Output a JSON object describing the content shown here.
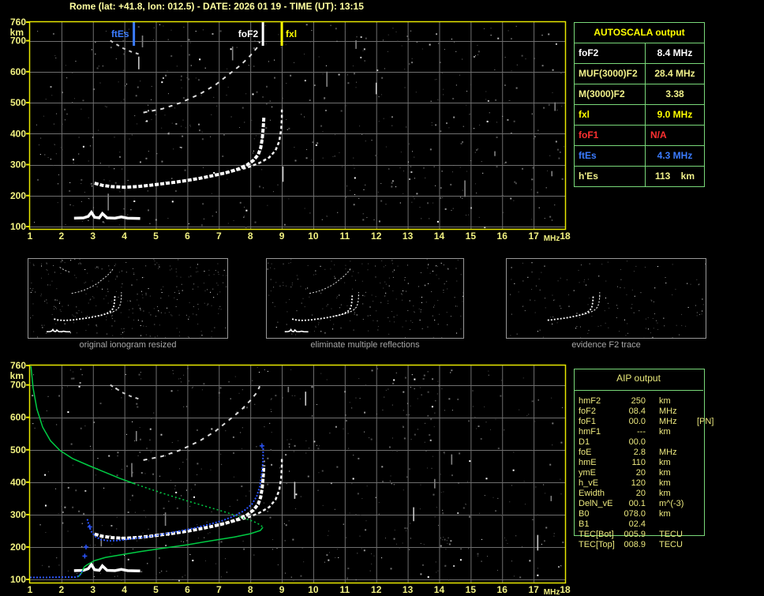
{
  "title": "Rome (lat: +41.8, lon: 012.5) - DATE: 2026 01 19 - TIME (UT): 13:15",
  "colors": {
    "background": "#000000",
    "plot_border": "#e8e800",
    "grid": "#6f6f6f",
    "axis_text": "#f0f080",
    "table_border": "#79d879",
    "bright_yellow": "#ffff00",
    "pale_yellow": "#f0f08a",
    "white": "#ffffff",
    "red": "#ff3030",
    "blue": "#3b7cff",
    "green_profile": "#00cc44",
    "caption_gray": "#a8a8a8"
  },
  "chart_data": {
    "type": "scatter",
    "title": "AUTOSCALA automatic ionogram scaling - Rome",
    "xlabel": "MHz",
    "ylabel": "km",
    "xlim": [
      1,
      18
    ],
    "ylim": [
      100,
      760
    ],
    "x_ticks": [
      1,
      2,
      3,
      4,
      5,
      6,
      7,
      8,
      9,
      10,
      11,
      12,
      13,
      14,
      15,
      16,
      17,
      18
    ],
    "y_ticks": [
      760,
      700,
      600,
      500,
      400,
      300,
      200,
      100
    ],
    "grid": true,
    "markers": [
      {
        "label": "ftEs",
        "f": 4.3,
        "color": "#3b7cff",
        "label_side": "left"
      },
      {
        "label": "foF2",
        "f": 8.4,
        "color": "#ffffff",
        "label_side": "left"
      },
      {
        "label": "fxl",
        "f": 9.0,
        "color": "#ffff00",
        "label_side": "right"
      }
    ],
    "series": [
      {
        "name": "f2-ordinary-trace",
        "color": "#ffffff",
        "width": 4,
        "dash": "5,2",
        "plots": [
          "top",
          "bottom",
          "t0",
          "t1",
          "t2"
        ],
        "points": [
          [
            3.05,
            240
          ],
          [
            3.3,
            233
          ],
          [
            3.6,
            229
          ],
          [
            4.0,
            227
          ],
          [
            4.4,
            229
          ],
          [
            4.8,
            233
          ],
          [
            5.2,
            238
          ],
          [
            5.6,
            243
          ],
          [
            6.0,
            249
          ],
          [
            6.4,
            256
          ],
          [
            6.8,
            264
          ],
          [
            7.2,
            273
          ],
          [
            7.6,
            285
          ],
          [
            7.9,
            299
          ],
          [
            8.1,
            314
          ],
          [
            8.25,
            332
          ],
          [
            8.33,
            354
          ],
          [
            8.38,
            384
          ],
          [
            8.41,
            418
          ],
          [
            8.43,
            452
          ]
        ]
      },
      {
        "name": "f2-extraordinary-trace",
        "color": "#f4f4f4",
        "width": 2.5,
        "dash": "4,3",
        "plots": [
          "top",
          "bottom",
          "t0",
          "t1",
          "t2"
        ],
        "points": [
          [
            6.9,
            268
          ],
          [
            7.4,
            277
          ],
          [
            7.9,
            290
          ],
          [
            8.3,
            306
          ],
          [
            8.6,
            323
          ],
          [
            8.8,
            346
          ],
          [
            8.92,
            376
          ],
          [
            8.98,
            415
          ],
          [
            9.0,
            452
          ],
          [
            9.0,
            478
          ]
        ]
      },
      {
        "name": "es-layer-trace",
        "color": "#ffffff",
        "width": 3.5,
        "dash": "",
        "plots": [
          "top",
          "bottom",
          "t0",
          "t1"
        ],
        "points": [
          [
            2.4,
            127
          ],
          [
            2.7,
            128
          ],
          [
            2.85,
            133
          ],
          [
            2.95,
            146
          ],
          [
            3.05,
            130
          ],
          [
            3.2,
            128
          ],
          [
            3.3,
            142
          ],
          [
            3.45,
            128
          ],
          [
            3.7,
            127
          ],
          [
            3.9,
            131
          ],
          [
            4.1,
            127
          ],
          [
            4.5,
            126
          ]
        ]
      },
      {
        "name": "second-hop-trace",
        "color": "#dddddd",
        "width": 2,
        "dash": "5,6",
        "plots": [
          "top",
          "bottom",
          "t0",
          "t1"
        ],
        "points": [
          [
            4.6,
            468
          ],
          [
            5.2,
            480
          ],
          [
            5.8,
            500
          ],
          [
            6.4,
            528
          ],
          [
            6.9,
            558
          ],
          [
            7.3,
            590
          ],
          [
            7.7,
            622
          ],
          [
            8.0,
            652
          ],
          [
            8.2,
            676
          ],
          [
            8.3,
            696
          ]
        ]
      },
      {
        "name": "second-hop-fragment",
        "color": "#cccccc",
        "width": 2,
        "dash": "4,5",
        "plots": [
          "top",
          "bottom",
          "t0"
        ],
        "points": [
          [
            3.55,
            700
          ],
          [
            3.75,
            688
          ],
          [
            3.95,
            676
          ],
          [
            4.2,
            665
          ],
          [
            4.45,
            657
          ]
        ]
      },
      {
        "name": "aip-profile-topside",
        "color": "#00cc44",
        "width": 1.5,
        "dash": "",
        "plots": [
          "bottom"
        ],
        "points": [
          [
            1.03,
            758
          ],
          [
            1.1,
            690
          ],
          [
            1.22,
            625
          ],
          [
            1.4,
            570
          ],
          [
            1.65,
            528
          ],
          [
            1.95,
            498
          ],
          [
            2.35,
            473
          ],
          [
            2.85,
            452
          ],
          [
            3.35,
            432
          ],
          [
            3.85,
            412
          ],
          [
            4.3,
            396
          ]
        ]
      },
      {
        "name": "aip-profile-dotted",
        "color": "#00cc44",
        "width": 1.5,
        "dash": "2,3",
        "plots": [
          "bottom"
        ],
        "points": [
          [
            4.3,
            396
          ],
          [
            4.8,
            379
          ],
          [
            5.4,
            360
          ],
          [
            6.0,
            342
          ],
          [
            6.6,
            325
          ],
          [
            7.2,
            308
          ],
          [
            7.7,
            292
          ],
          [
            8.1,
            279
          ],
          [
            8.32,
            268
          ],
          [
            8.4,
            261
          ]
        ]
      },
      {
        "name": "aip-profile-bottomside",
        "color": "#00cc44",
        "width": 1.5,
        "dash": "",
        "plots": [
          "bottom"
        ],
        "points": [
          [
            8.4,
            261
          ],
          [
            8.32,
            251
          ],
          [
            8.0,
            241
          ],
          [
            7.5,
            231
          ],
          [
            6.8,
            220
          ],
          [
            6.0,
            207
          ],
          [
            5.2,
            196
          ],
          [
            4.5,
            186
          ],
          [
            3.9,
            176
          ],
          [
            3.4,
            168
          ],
          [
            3.05,
            158
          ],
          [
            2.9,
            150
          ],
          [
            2.8,
            144
          ],
          [
            2.72,
            138
          ],
          [
            2.68,
            130
          ],
          [
            2.64,
            120
          ],
          [
            2.58,
            112
          ],
          [
            2.5,
            107
          ]
        ]
      },
      {
        "name": "fitted-trace",
        "color": "#2b55ff",
        "width": 2,
        "dash": "2,2",
        "plots": [
          "bottom"
        ],
        "points": [
          [
            2.82,
            286
          ],
          [
            2.88,
            264
          ],
          [
            2.96,
            246
          ],
          [
            3.08,
            232
          ],
          [
            3.25,
            223
          ],
          [
            3.5,
            219
          ],
          [
            3.8,
            220
          ],
          [
            4.2,
            225
          ],
          [
            4.7,
            231
          ],
          [
            5.2,
            239
          ],
          [
            5.7,
            248
          ],
          [
            6.2,
            258
          ],
          [
            6.7,
            270
          ],
          [
            7.1,
            281
          ],
          [
            7.5,
            296
          ],
          [
            7.8,
            312
          ],
          [
            8.05,
            332
          ],
          [
            8.2,
            356
          ],
          [
            8.3,
            386
          ],
          [
            8.36,
            424
          ],
          [
            8.4,
            462
          ],
          [
            8.41,
            508
          ]
        ]
      },
      {
        "name": "fitted-floor",
        "color": "#2b55ff",
        "width": 2,
        "dash": "2,2",
        "plots": [
          "bottom"
        ],
        "points": [
          [
            1.0,
            106
          ],
          [
            1.5,
            106
          ],
          [
            2.0,
            107
          ],
          [
            2.45,
            107
          ],
          [
            2.55,
            111
          ],
          [
            2.62,
            118
          ],
          [
            2.66,
            126
          ]
        ]
      },
      {
        "name": "fitted-marks",
        "color": "#2b55ff",
        "width": 1.5,
        "dash": "",
        "type": "plus",
        "plots": [
          "bottom"
        ],
        "points": [
          [
            2.74,
            172
          ],
          [
            2.78,
            200
          ],
          [
            2.9,
            262
          ],
          [
            8.37,
            512
          ]
        ]
      }
    ]
  },
  "autoscala_table": {
    "title": "AUTOSCALA output",
    "rows": [
      {
        "param": "foF2",
        "value": "8.4 MHz",
        "color": "#ffffff"
      },
      {
        "param": "MUF(3000)F2",
        "value": "28.4 MHz",
        "color": "#f0f08a"
      },
      {
        "param": "M(3000)F2",
        "value": "3.38",
        "color": "#f0f08a"
      },
      {
        "param": "fxl",
        "value": "9.0 MHz",
        "color": "#ffff00"
      },
      {
        "param": "foF1",
        "value": "N/A",
        "color": "#ff3030"
      },
      {
        "param": "ftEs",
        "value": "4.3 MHz",
        "color": "#3b7cff"
      },
      {
        "param": "h'Es",
        "value": "113    km",
        "color": "#f0f08a"
      }
    ]
  },
  "thumbnails": [
    {
      "caption": "original ionogram resized"
    },
    {
      "caption": "eliminate multiple reflections"
    },
    {
      "caption": "evidence F2 trace"
    }
  ],
  "aip_table": {
    "title": "AIP output",
    "rows": [
      {
        "param": "hmF2",
        "value": "250",
        "unit": "km",
        "note": ""
      },
      {
        "param": "foF2",
        "value": "08.4",
        "unit": "MHz",
        "note": ""
      },
      {
        "param": "foF1",
        "value": "00.0",
        "unit": "MHz",
        "note": "[PN]"
      },
      {
        "param": "hmF1",
        "value": "---",
        "unit": "km",
        "note": ""
      },
      {
        "param": "D1",
        "value": "00.0",
        "unit": "",
        "note": ""
      },
      {
        "param": "foE",
        "value": "2.8",
        "unit": "MHz",
        "note": ""
      },
      {
        "param": "hmE",
        "value": "110",
        "unit": "km",
        "note": ""
      },
      {
        "param": "ymE",
        "value": "20",
        "unit": "km",
        "note": ""
      },
      {
        "param": "h_vE",
        "value": "120",
        "unit": "km",
        "note": ""
      },
      {
        "param": "Ewidth",
        "value": "20",
        "unit": "km",
        "note": ""
      },
      {
        "param": "DelN_vE",
        "value": "00.1",
        "unit": "m^(-3)",
        "note": ""
      },
      {
        "param": "B0",
        "value": "078.0",
        "unit": "km",
        "note": ""
      },
      {
        "param": "B1",
        "value": "02.4",
        "unit": "",
        "note": ""
      },
      {
        "param": "TEC[Bot]",
        "value": "005.9",
        "unit": "TECU",
        "note": ""
      },
      {
        "param": "TEC[Top]",
        "value": "008.9",
        "unit": "TECU",
        "note": ""
      }
    ]
  }
}
